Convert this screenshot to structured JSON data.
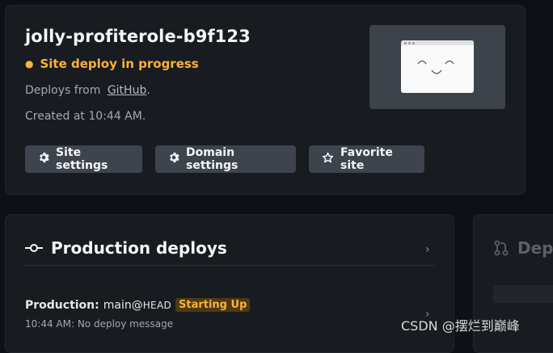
{
  "site": {
    "name": "jolly-profiterole-b9f123",
    "status": "Site deploy in progress",
    "status_color": "#fbb13d",
    "deploys_from_prefix": "Deploys from",
    "deploys_from_provider": "GitHub",
    "deploys_from_suffix": ".",
    "created_at": "Created at 10:44 AM.",
    "buttons": {
      "site_settings": "Site settings",
      "domain_settings": "Domain settings",
      "favorite_site": "Favorite site"
    },
    "buttons_icons": [
      "gear-icon",
      "gear-icon",
      "star-icon"
    ]
  },
  "production_deploys": {
    "title": "Production deploys",
    "item": {
      "label": "Production:",
      "branch": "main@",
      "ref": "HEAD",
      "badge": "Starting Up",
      "meta": "10:44 AM: No deploy message"
    }
  },
  "side_panel": {
    "title_partial": "Dep"
  },
  "watermark": "CSDN @摆烂到巅峰"
}
